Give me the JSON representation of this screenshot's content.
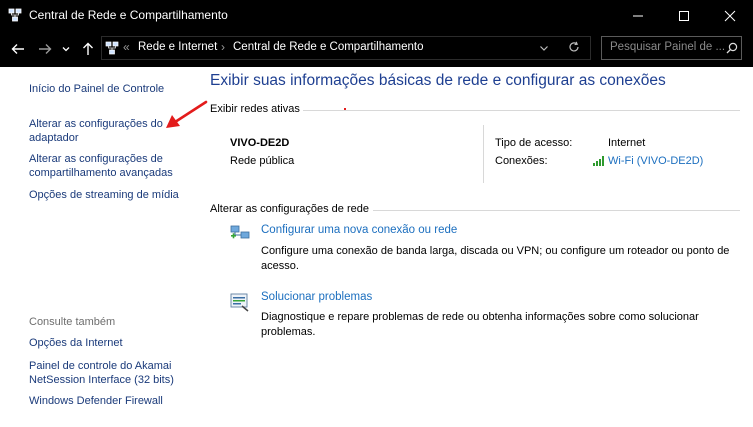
{
  "window": {
    "title": "Central de Rede e Compartilhamento",
    "minimize": "—",
    "maximize": "☐",
    "close": "✕"
  },
  "nav": {
    "back": "←",
    "forward": "→",
    "recent": "⌄",
    "up": "↑",
    "crumb_overflow": "«",
    "crumbs": [
      "Rede e Internet",
      "Central de Rede e Compartilhamento"
    ],
    "crumb_sep": "›",
    "dropdown": "⌄",
    "refresh": "↻",
    "search_placeholder": "Pesquisar Painel de ...",
    "search_icon": "magnifier-icon"
  },
  "sidebar": {
    "home": "Início do Painel de Controle",
    "links": [
      [
        "Alterar as configurações do",
        "adaptador"
      ],
      [
        "Alterar as configurações de",
        "compartilhamento avançadas"
      ],
      [
        "Opções de streaming de mídia"
      ]
    ],
    "see_also_label": "Consulte também",
    "see_also": [
      [
        "Opções da Internet"
      ],
      [
        "Painel de controle do Akamai",
        "NetSession Interface (32 bits)"
      ],
      [
        "Windows Defender Firewall"
      ]
    ]
  },
  "main": {
    "heading": "Exibir suas informações básicas de rede e configurar as conexões",
    "active_networks_label": "Exibir redes ativas",
    "network": {
      "name": "VIVO-DE2D",
      "type": "Rede pública",
      "access_label": "Tipo de acesso:",
      "access_value": "Internet",
      "connections_label": "Conexões:",
      "connections_value": "Wi-Fi (VIVO-DE2D)"
    },
    "change_settings_label": "Alterar as configurações de rede",
    "tasks": [
      {
        "icon": "new-connection-icon",
        "title": "Configurar uma nova conexão ou rede",
        "desc": [
          "Configure uma conexão de banda larga, discada ou VPN; ou configure um roteador ou ponto de",
          "acesso."
        ]
      },
      {
        "icon": "troubleshoot-icon",
        "title": "Solucionar problemas",
        "desc": [
          "Diagnostique e repare problemas de rede ou obtenha informações sobre como solucionar",
          "problemas."
        ]
      }
    ]
  },
  "colors": {
    "link": "#1c6fbf",
    "heading": "#1e3f91",
    "annotation": "#e31b1b"
  }
}
